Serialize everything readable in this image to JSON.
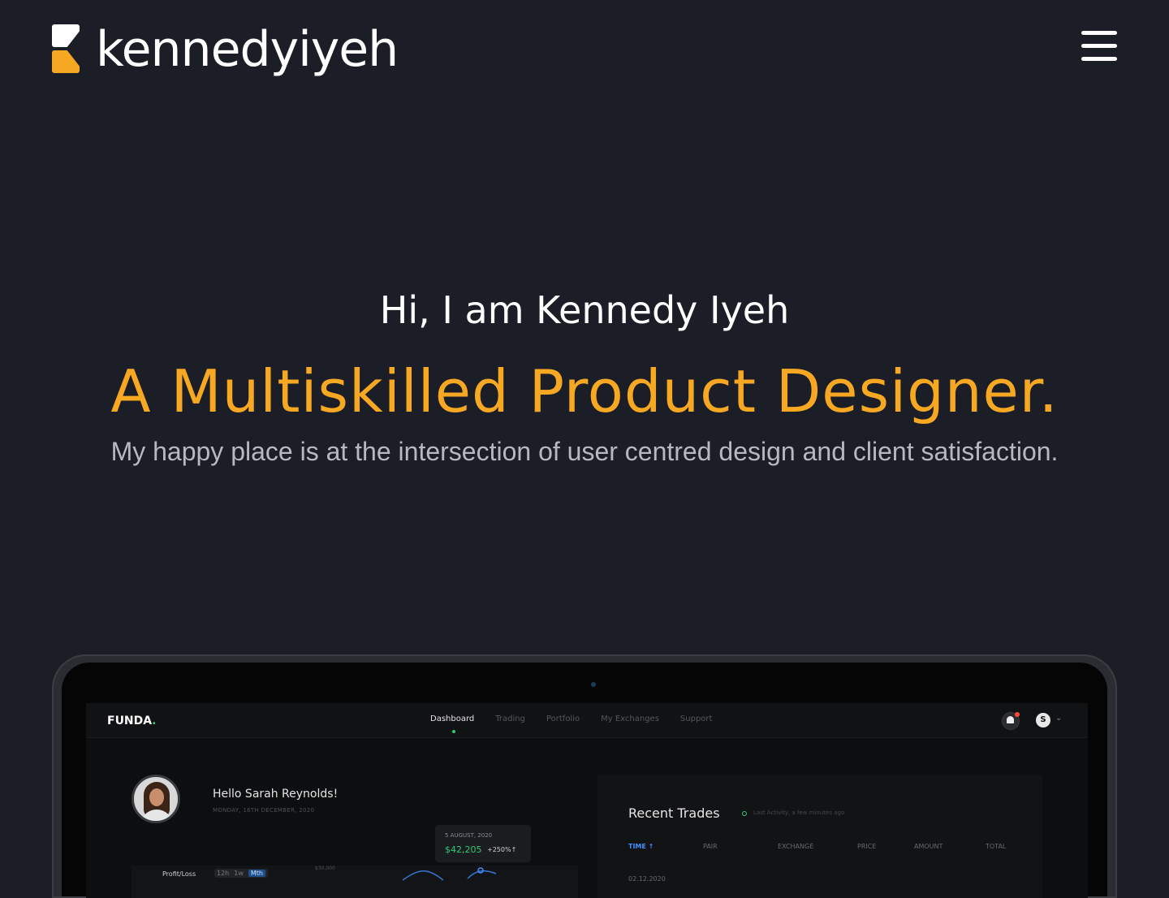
{
  "header": {
    "brand_name": "kennedyiyeh",
    "menu_icon": "hamburger-menu-icon"
  },
  "hero": {
    "greeting": "Hi, I am Kennedy Iyeh",
    "headline": "A Multiskilled Product Designer.",
    "tagline": "My happy place is at the intersection of user centred design and client satisfaction."
  },
  "colors": {
    "background": "#1b1d27",
    "accent": "#f7a823",
    "text": "#ffffff",
    "muted": "#b7b9c1",
    "dashboard_green": "#2ecc71",
    "dashboard_blue": "#3f8fff"
  },
  "dashboard": {
    "logo": "FUNDA",
    "logo_dot": ".",
    "nav": [
      "Dashboard",
      "Trading",
      "Portfolio",
      "My Exchanges",
      "Support"
    ],
    "user_initial": "S",
    "greeting": "Hello Sarah Reynolds!",
    "date": "MONDAY, 16TH DECEMBER, 2020",
    "tooltip": {
      "date": "5 AUGUST, 2020",
      "value": "$42,205",
      "change": "+250%↑"
    },
    "profit_loss": {
      "label": "Profit/Loss",
      "tabs": [
        "12h",
        "1w",
        "Mth"
      ],
      "axis_value": "$30,000"
    },
    "recent_trades": {
      "title": "Recent Trades",
      "activity": "Last Activity, a few minutes ago",
      "columns": [
        "TIME ↑",
        "PAIR",
        "EXCHANGE",
        "PRICE",
        "AMOUNT",
        "TOTAL"
      ],
      "first_time": "02.12.2020"
    }
  }
}
